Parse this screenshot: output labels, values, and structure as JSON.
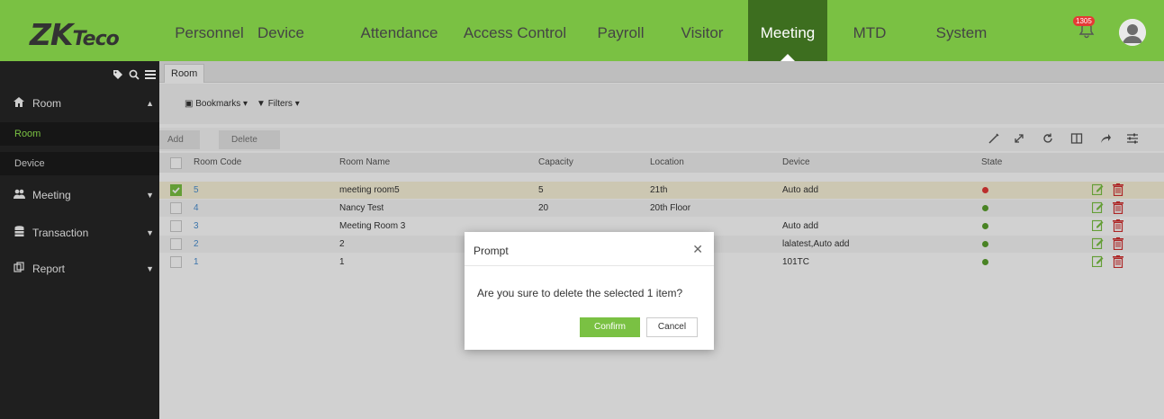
{
  "brand": {
    "logo_main": "ZK",
    "logo_sub": "Teco"
  },
  "nav": {
    "items": [
      "Personnel",
      "Device",
      "Attendance",
      "Access Control",
      "Payroll",
      "Visitor",
      "Meeting",
      "MTD",
      "System"
    ],
    "active": "Meeting",
    "notification_count": "1305"
  },
  "sidebar": {
    "groups": [
      {
        "label": "Room",
        "icon": "home-icon",
        "sub": [
          "Room",
          "Device"
        ],
        "active_sub": "Room"
      },
      {
        "label": "Meeting",
        "icon": "people-icon"
      },
      {
        "label": "Transaction",
        "icon": "database-icon"
      },
      {
        "label": "Report",
        "icon": "report-icon"
      }
    ]
  },
  "tab": {
    "label": "Room"
  },
  "filters": {
    "bookmarks": "Bookmarks",
    "filters": "Filters"
  },
  "toolbar": {
    "add": "Add",
    "delete": "Delete"
  },
  "table": {
    "columns": [
      "Room Code",
      "Room Name",
      "Capacity",
      "Location",
      "Device",
      "State"
    ],
    "rows": [
      {
        "code": "5",
        "name": "meeting room5",
        "capacity": "5",
        "location": "21th",
        "device": "Auto add",
        "state": "disabled",
        "selected": true
      },
      {
        "code": "4",
        "name": "Nancy Test",
        "capacity": "20",
        "location": "20th Floor",
        "device": "",
        "state": "enabled",
        "selected": false
      },
      {
        "code": "3",
        "name": "Meeting Room 3",
        "capacity": "",
        "location": "",
        "device": "Auto add",
        "state": "enabled",
        "selected": false
      },
      {
        "code": "2",
        "name": "2",
        "capacity": "",
        "location": "",
        "device": "lalatest,Auto add",
        "state": "enabled",
        "selected": false
      },
      {
        "code": "1",
        "name": "1",
        "capacity": "",
        "location": "",
        "device": "101TC",
        "state": "enabled",
        "selected": false
      }
    ]
  },
  "dialog": {
    "title": "Prompt",
    "message": "Are you sure to delete the selected 1 item?",
    "confirm": "Confirm",
    "cancel": "Cancel"
  },
  "colors": {
    "brand_green": "#7ac143",
    "nav_active": "#3d6e1f",
    "link": "#4a8fd1",
    "state_red": "#e53935",
    "state_green": "#5aa02c"
  }
}
